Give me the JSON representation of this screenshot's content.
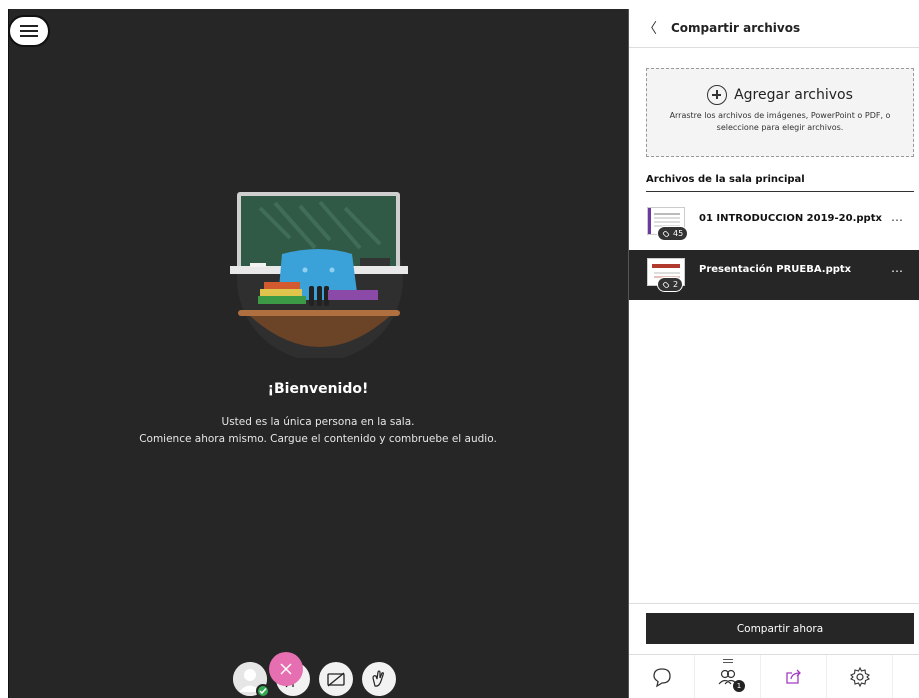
{
  "main": {
    "welcome_title": "¡Bienvenido!",
    "welcome_line1": "Usted es la única persona en la sala.",
    "welcome_line2": "Comience ahora mismo. Cargue el contenido y combruebe el audio."
  },
  "panel": {
    "title": "Compartir archivos",
    "dropzone": {
      "label": "Agregar archivos",
      "description": "Arrastre los archivos de imágenes, PowerPoint o PDF, o seleccione para elegir archivos."
    },
    "section_label": "Archivos de la sala principal",
    "files": [
      {
        "name": "01 INTRODUCCION 2019-20.pptx",
        "count": "45",
        "selected": false
      },
      {
        "name": "Presentación PRUEBA.pptx",
        "count": "2",
        "selected": true
      }
    ],
    "share_button": "Compartir ahora",
    "tabs": {
      "attendees_badge": "1"
    }
  },
  "icons": [
    "menu-icon",
    "chevron-left-icon",
    "plus-circle-icon",
    "layers-icon",
    "more-icon",
    "microphone-off-icon",
    "camera-off-icon",
    "hand-raise-icon",
    "chat-icon",
    "attendees-icon",
    "share-icon",
    "settings-icon",
    "close-icon"
  ],
  "colors": {
    "stage_bg": "#262626",
    "selected_row": "#262626",
    "close_button": "#e56fb0",
    "presence_ok": "#34a853"
  }
}
